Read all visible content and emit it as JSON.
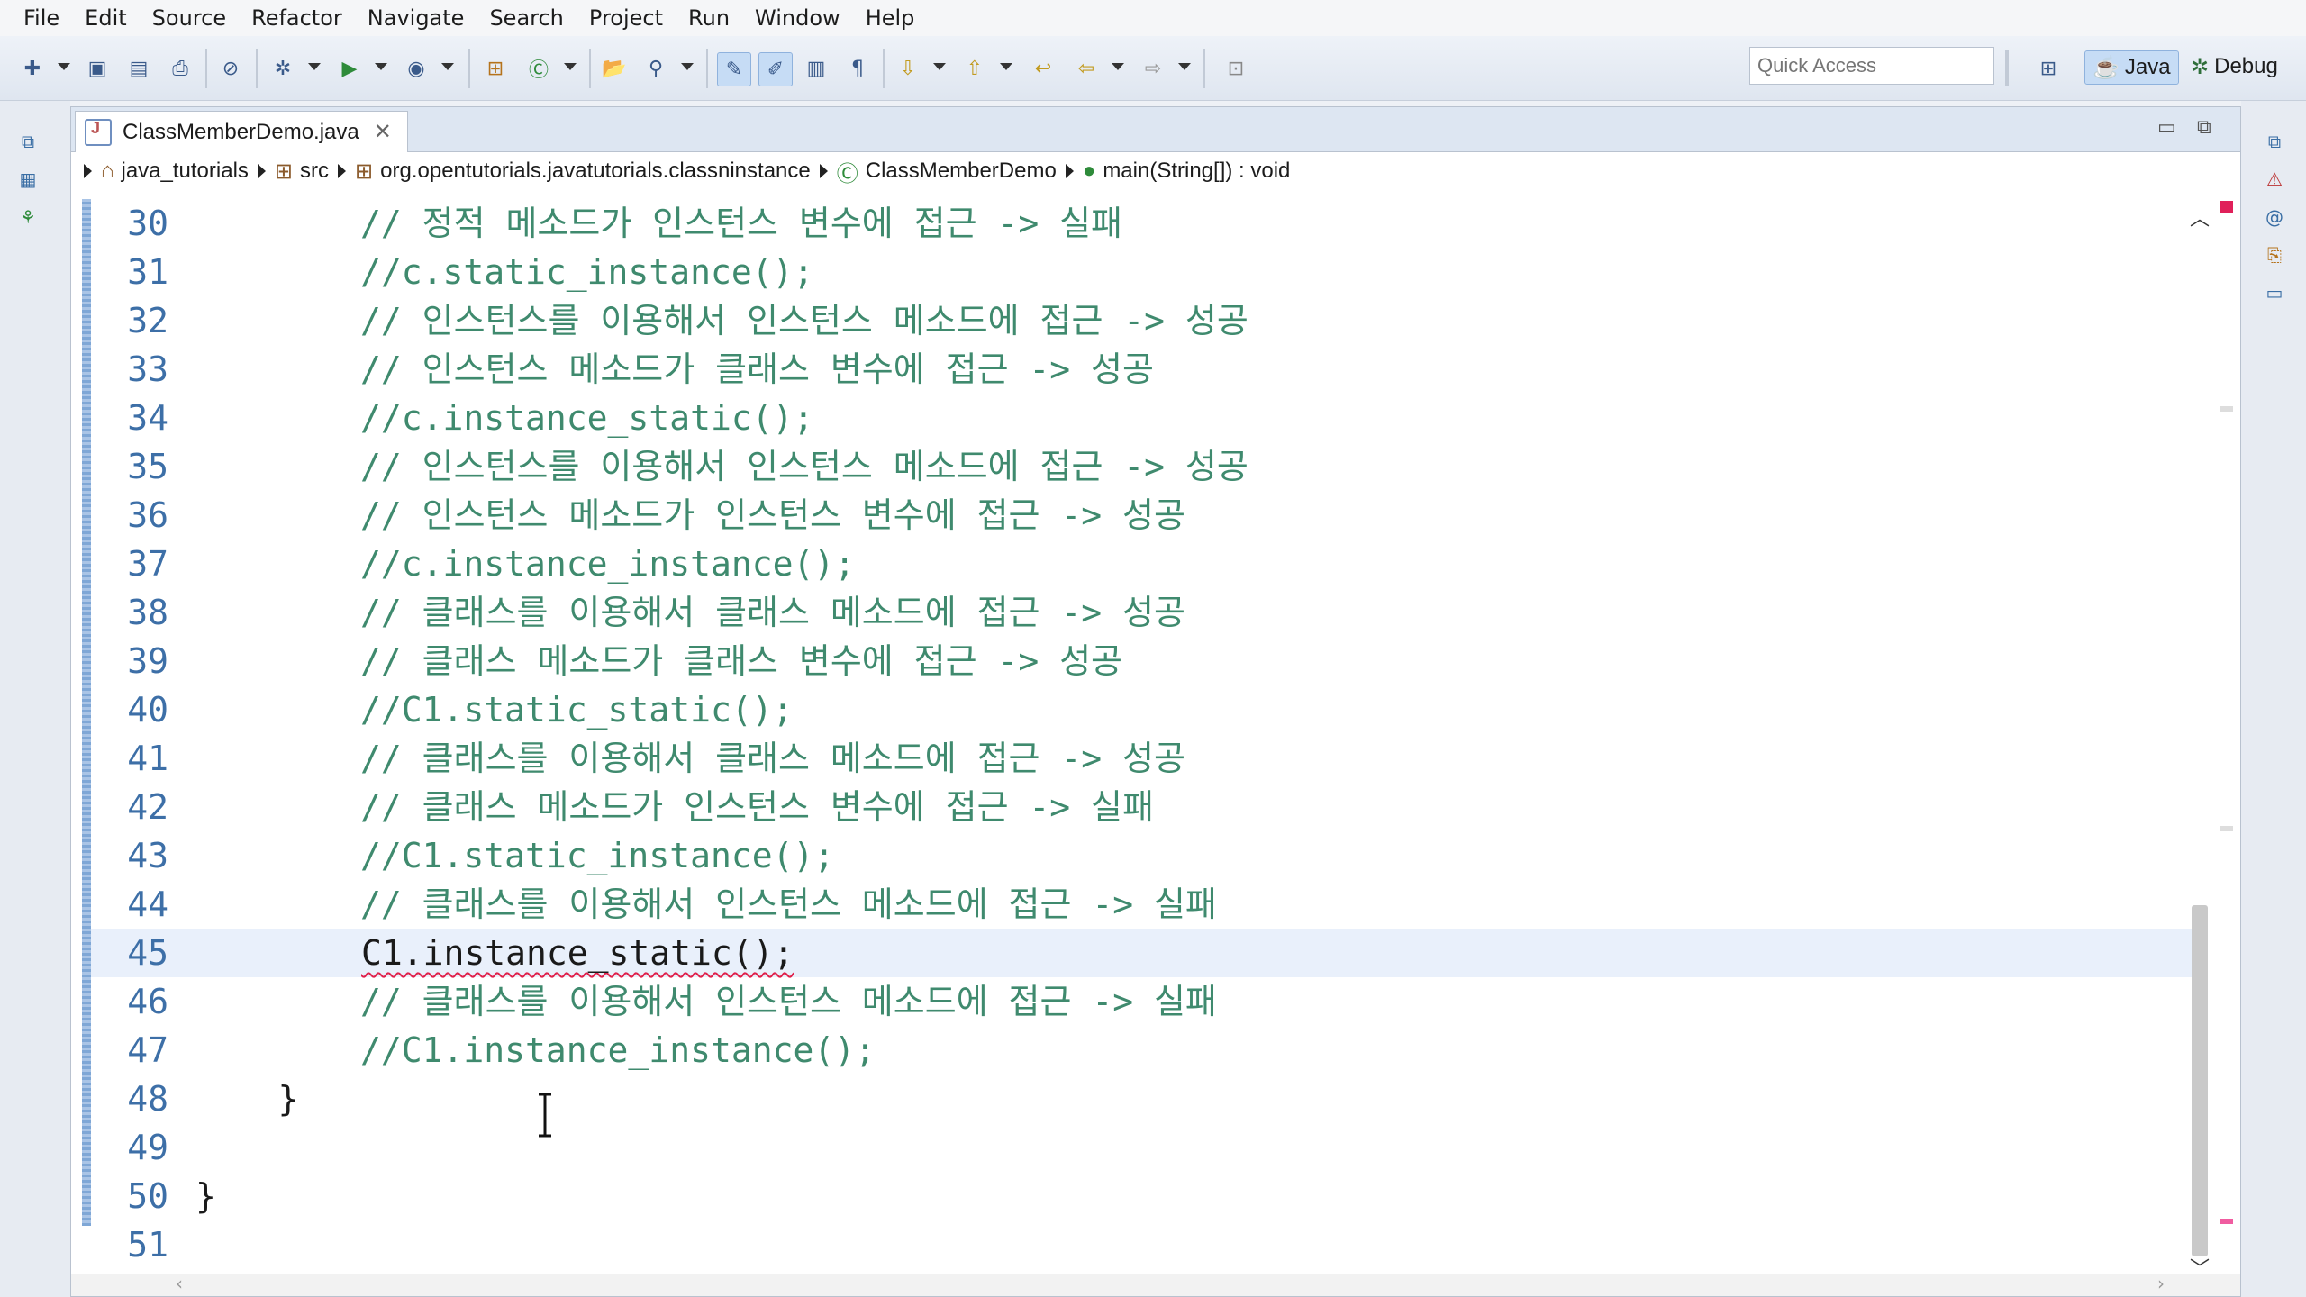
{
  "menu": [
    "File",
    "Edit",
    "Source",
    "Refactor",
    "Navigate",
    "Search",
    "Project",
    "Run",
    "Window",
    "Help"
  ],
  "toolbar": {
    "quick_access_placeholder": "Quick Access",
    "perspectives": {
      "java": "Java",
      "debug": "Debug"
    }
  },
  "editor": {
    "tab_title": "ClassMemberDemo.java",
    "breadcrumb": [
      "java_tutorials",
      "src",
      "org.opentutorials.javatutorials.classninstance",
      "ClassMemberDemo",
      "main(String[]) : void"
    ],
    "lines": [
      {
        "num": "30",
        "text": "        // 정적 메소드가 인스턴스 변수에 접근 -> 실패",
        "kind": "comment"
      },
      {
        "num": "31",
        "text": "        //c.static_instance();",
        "kind": "comment"
      },
      {
        "num": "32",
        "text": "        // 인스턴스를 이용해서 인스턴스 메소드에 접근 -> 성공",
        "kind": "comment"
      },
      {
        "num": "33",
        "text": "        // 인스턴스 메소드가 클래스 변수에 접근 -> 성공",
        "kind": "comment"
      },
      {
        "num": "34",
        "text": "        //c.instance_static();",
        "kind": "comment"
      },
      {
        "num": "35",
        "text": "        // 인스턴스를 이용해서 인스턴스 메소드에 접근 -> 성공",
        "kind": "comment"
      },
      {
        "num": "36",
        "text": "        // 인스턴스 메소드가 인스턴스 변수에 접근 -> 성공",
        "kind": "comment"
      },
      {
        "num": "37",
        "text": "        //c.instance_instance();",
        "kind": "comment"
      },
      {
        "num": "38",
        "text": "        // 클래스를 이용해서 클래스 메소드에 접근 -> 성공",
        "kind": "comment"
      },
      {
        "num": "39",
        "text": "        // 클래스 메소드가 클래스 변수에 접근 -> 성공",
        "kind": "comment"
      },
      {
        "num": "40",
        "text": "        //C1.static_static();",
        "kind": "comment"
      },
      {
        "num": "41",
        "text": "        // 클래스를 이용해서 클래스 메소드에 접근 -> 성공",
        "kind": "comment"
      },
      {
        "num": "42",
        "text": "        // 클래스 메소드가 인스턴스 변수에 접근 -> 실패",
        "kind": "comment"
      },
      {
        "num": "43",
        "text": "        //C1.static_instance();",
        "kind": "comment"
      },
      {
        "num": "44",
        "text": "        // 클래스를 이용해서 인스턴스 메소드에 접근 -> 실패",
        "kind": "comment"
      },
      {
        "num": "45",
        "text": "C1.instance_static();",
        "kind": "error"
      },
      {
        "num": "46",
        "text": "        // 클래스를 이용해서 인스턴스 메소드에 접근 -> 실패",
        "kind": "comment"
      },
      {
        "num": "47",
        "text": "        //C1.instance_instance();",
        "kind": "comment"
      },
      {
        "num": "48",
        "text": "    }",
        "kind": "code"
      },
      {
        "num": "49",
        "text": "",
        "kind": "code"
      },
      {
        "num": "50",
        "text": "}",
        "kind": "code"
      },
      {
        "num": "51",
        "text": "",
        "kind": "code"
      }
    ],
    "current_line": "45"
  }
}
